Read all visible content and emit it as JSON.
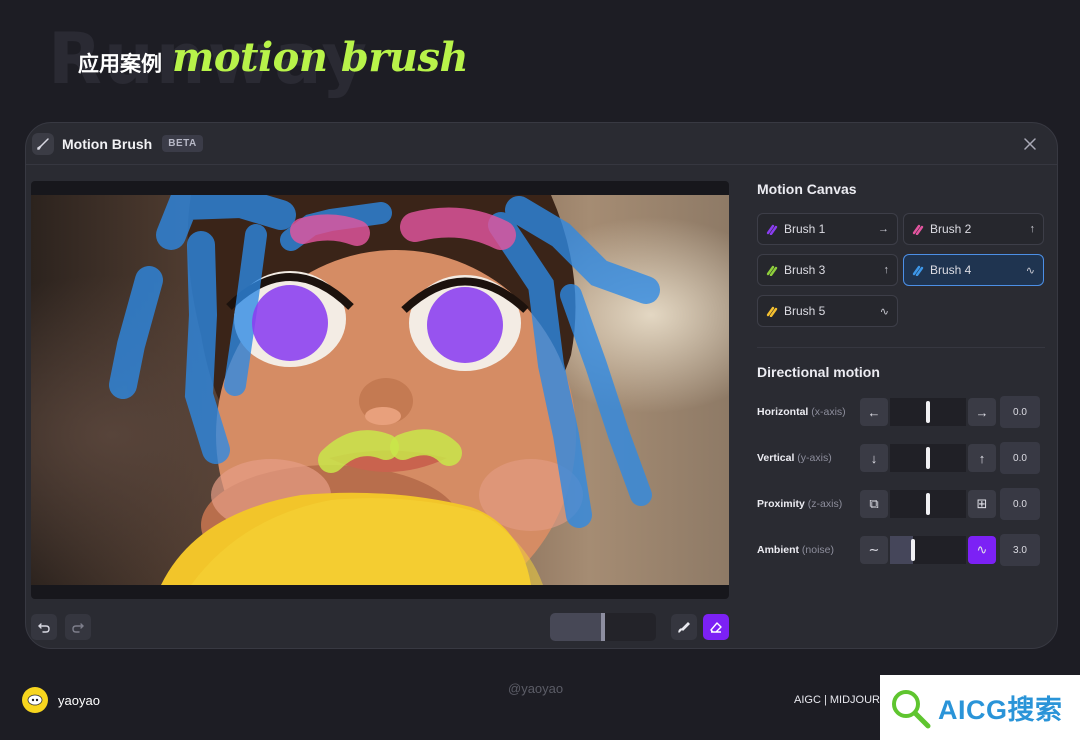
{
  "slide": {
    "ghost_text": "Runway",
    "heading_zh": "应用案例",
    "heading_accent": "motion brush",
    "accent_color": "#b8f34a"
  },
  "window": {
    "title": "Motion Brush",
    "badge": "BETA",
    "close_icon": "close-icon"
  },
  "canvas": {
    "subject": "3D-rendered girl with painted motion brush regions",
    "brush_regions": [
      {
        "name": "Brush 1",
        "color": "#8a3df0"
      },
      {
        "name": "Brush 2",
        "color": "#e2559f"
      },
      {
        "name": "Brush 3",
        "color": "#c9e64a"
      },
      {
        "name": "Brush 4",
        "color": "#3d97e8"
      },
      {
        "name": "Brush 5",
        "color": "#f5d638"
      }
    ]
  },
  "toolbar": {
    "undo_icon": "undo-icon",
    "redo_icon": "redo-icon",
    "brush_size_level": 0.48,
    "brush_icon": "brush-icon",
    "eraser_icon": "eraser-icon",
    "eraser_active": true
  },
  "panel": {
    "motion_canvas_title": "Motion Canvas",
    "brushes": [
      {
        "label": "Brush 1",
        "color": "#8a3df0",
        "direction_icon": "arrow-right-icon",
        "glyph": "→",
        "selected": false
      },
      {
        "label": "Brush 2",
        "color": "#e2559f",
        "direction_icon": "arrow-up-icon",
        "glyph": "↑",
        "selected": false
      },
      {
        "label": "Brush 3",
        "color": "#8fcf3c",
        "direction_icon": "arrow-up-icon",
        "glyph": "↑",
        "selected": false
      },
      {
        "label": "Brush 4",
        "color": "#3d97e8",
        "direction_icon": "noise-icon",
        "glyph": "∿",
        "selected": true
      },
      {
        "label": "Brush 5",
        "color": "#f5c030",
        "direction_icon": "noise-icon",
        "glyph": "∿",
        "selected": false
      }
    ],
    "directional_title": "Directional motion",
    "axes": [
      {
        "name": "Horizontal",
        "sub": "(x-axis)",
        "left_icon": "arrow-left-icon",
        "left_glyph": "←",
        "right_icon": "arrow-right-icon",
        "right_glyph": "→",
        "level": 0.5,
        "value": "0.0"
      },
      {
        "name": "Vertical",
        "sub": "(y-axis)",
        "left_icon": "arrow-down-icon",
        "left_glyph": "↓",
        "right_icon": "arrow-up-icon",
        "right_glyph": "↑",
        "level": 0.5,
        "value": "0.0"
      },
      {
        "name": "Proximity",
        "sub": "(z-axis)",
        "left_icon": "shrink-icon",
        "left_glyph": "⧉",
        "right_icon": "expand-icon",
        "right_glyph": "⊞",
        "level": 0.5,
        "value": "0.0"
      },
      {
        "name": "Ambient",
        "sub": "(noise)",
        "left_icon": "low-noise-icon",
        "left_glyph": "∼",
        "right_icon": "high-noise-icon",
        "right_glyph": "∿",
        "level": 0.3,
        "value": "3.0"
      }
    ]
  },
  "footer": {
    "author": "yaoyao",
    "watermark": "@yaoyao",
    "tags": "AIGC | MIDJOUR",
    "badge_text": "AICG搜索"
  }
}
